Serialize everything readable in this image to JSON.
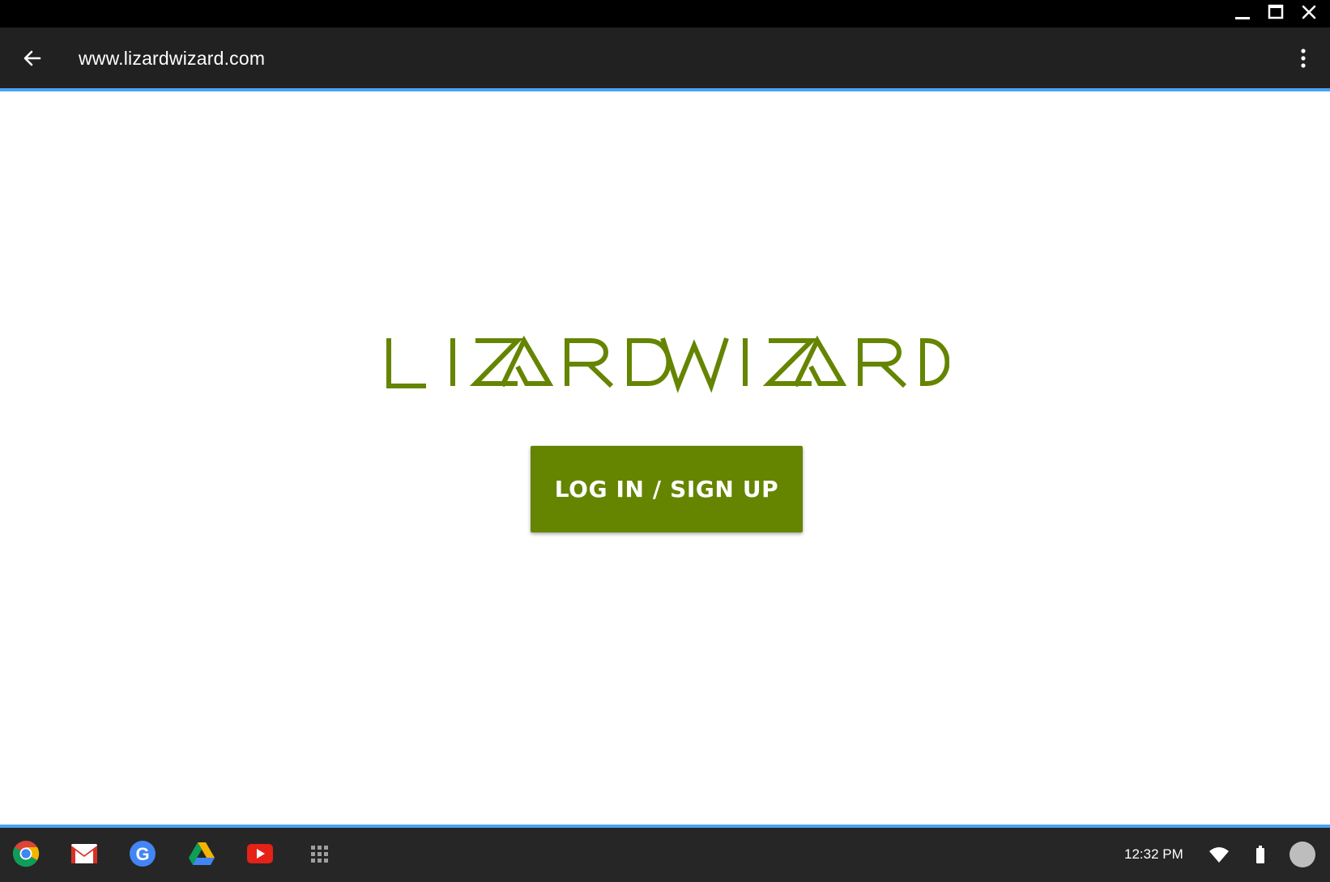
{
  "window": {
    "controls": [
      "minimize-icon",
      "maximize-icon",
      "close-icon"
    ]
  },
  "app_bar": {
    "url": "www.lizardwizard.com",
    "back_icon": "arrow-back-icon",
    "menu_icon": "more-vert-icon"
  },
  "main": {
    "logo_text": "LIZARD WIZARD",
    "login_button_label": "LOG IN / SIGN UP"
  },
  "shelf": {
    "apps": [
      "chrome-icon",
      "gmail-icon",
      "google-icon",
      "drive-icon",
      "youtube-icon",
      "app-launcher-icon"
    ],
    "clock": "12:32 PM",
    "tray": [
      "wifi-icon",
      "battery-icon",
      "avatar"
    ]
  },
  "colors": {
    "brand_green": "#658501",
    "accent_blue": "#4aa3f0",
    "app_bar_bg": "#212121",
    "shelf_bg": "#262626"
  }
}
